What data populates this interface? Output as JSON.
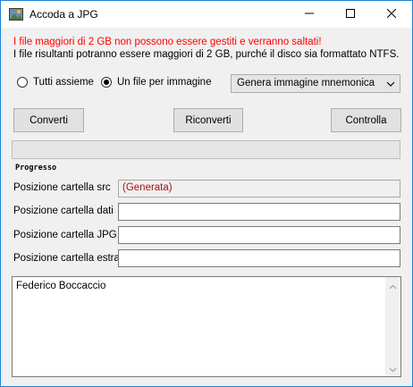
{
  "window": {
    "title": "Accoda a JPG",
    "accent_color": "#1e86d8"
  },
  "messages": {
    "warning": "I file maggiori di 2 GB non possono essere gestiti e verranno saltati!",
    "info": "I file risultanti potranno essere maggiori di 2 GB, purché il disco sia formattato NTFS."
  },
  "mode": {
    "options": [
      {
        "label": "Tutti assieme",
        "checked": false
      },
      {
        "label": "Un file per immagine",
        "checked": true
      }
    ]
  },
  "combo": {
    "selected": "Genera immagine mnemonica"
  },
  "buttons": {
    "converti": "Converti",
    "riconverti": "Riconverti",
    "controlla": "Controlla"
  },
  "progress": {
    "label": "Progresso",
    "value": 0
  },
  "fields": [
    {
      "label": "Posizione cartella src",
      "value": "(Generata)"
    },
    {
      "label": "Posizione cartella dati",
      "value": ""
    },
    {
      "label": "Posizione cartella JPG",
      "value": ""
    },
    {
      "label": "Posizione cartella estratti",
      "value": ""
    }
  ],
  "notes": {
    "text": "Federico Boccaccio"
  },
  "icons": {
    "app": "app-icon",
    "minimize": "minimize-icon",
    "maximize": "maximize-icon",
    "close": "close-icon"
  }
}
